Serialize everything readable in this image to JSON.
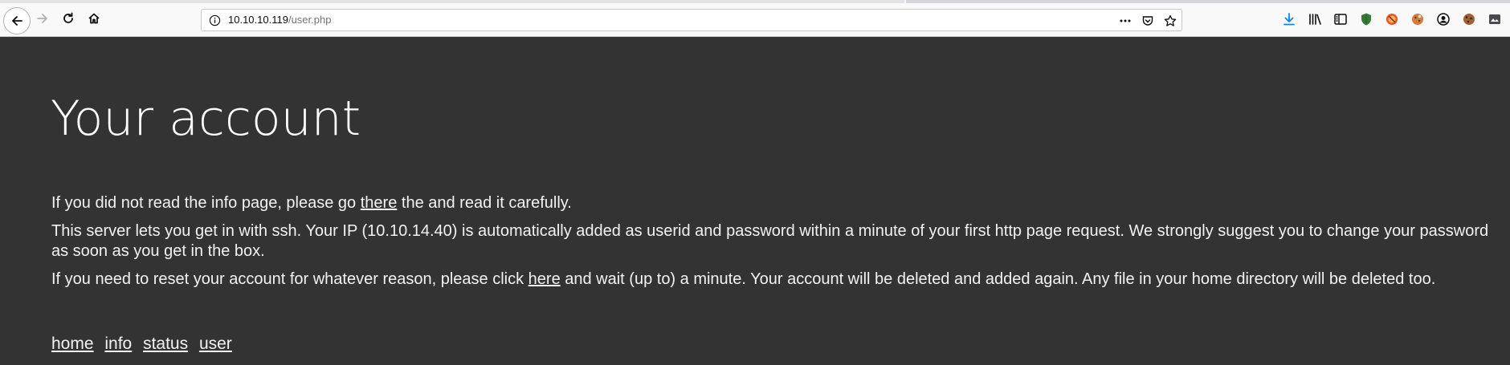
{
  "browser": {
    "url_host": "10.10.10.119",
    "url_path": "/user.php",
    "icons": {
      "back": "back-arrow-icon",
      "forward": "forward-arrow-icon",
      "reload": "reload-icon",
      "home": "home-icon",
      "info": "info-icon",
      "page_actions": "more-horizontal-icon",
      "pocket": "pocket-icon",
      "bookmark": "star-icon",
      "downloads": "download-icon",
      "library": "library-icon",
      "sidebar": "sidebar-icon",
      "ext1": "shield-extension-icon",
      "ext2": "block-extension-icon",
      "ext3": "cookie-extension-icon",
      "account": "account-icon",
      "ext4": "cookie-manager-icon",
      "ext5": "screenshot-extension-icon"
    }
  },
  "page": {
    "title": "Your account",
    "p1": {
      "before": "If you did not read the info page, please go ",
      "link": "there",
      "after": " the and read it carefully."
    },
    "p2": "This server lets you get in with ssh. Your IP (10.10.14.40) is automatically added as userid and password within a minute of your first http page request. We strongly suggest you to change your password as soon as you get in the box.",
    "p3": {
      "before": "If you need to reset your account for whatever reason, please click ",
      "link": "here",
      "after": " and wait (up to) a minute. Your account will be deleted and added again. Any file in your home directory will be deleted too."
    },
    "nav": [
      "home",
      "info",
      "status",
      "user"
    ]
  },
  "colors": {
    "page_background": "#333333",
    "text": "#f2f2f2",
    "toolbar": "#f9f9fa",
    "download_accent": "#0a84ff"
  }
}
